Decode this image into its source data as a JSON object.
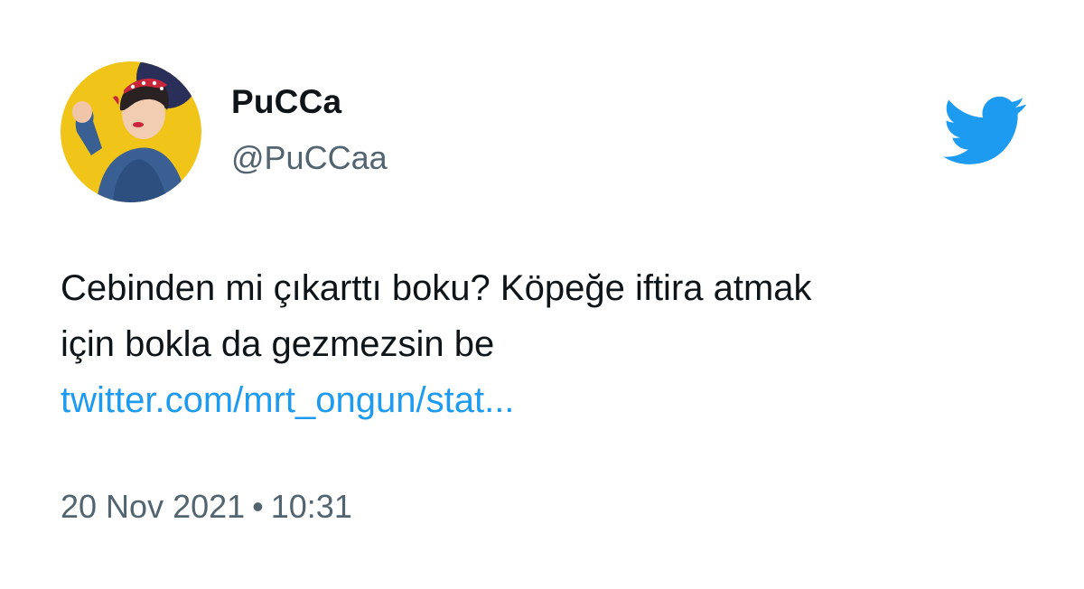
{
  "author": {
    "display_name": "PuCCa",
    "handle": "@PuCCaa",
    "avatar_icon": "avatar-photo"
  },
  "brand": {
    "icon": "twitter-bird-icon",
    "color": "#1d9bf0"
  },
  "tweet": {
    "line1": "Cebinden mi çıkarttı boku? Köpeğe iftira atmak",
    "line2": "için bokla da gezmezsin be",
    "link_text": "twitter.com/mrt_ongun/stat..."
  },
  "meta": {
    "date": "20 Nov 2021",
    "separator": "•",
    "time": "10:31"
  }
}
